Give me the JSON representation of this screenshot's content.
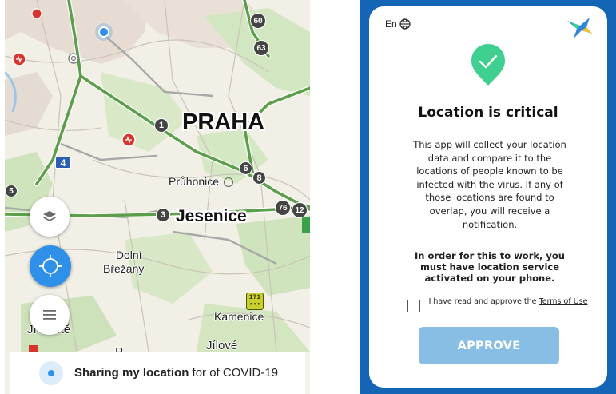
{
  "map_screen": {
    "labels": {
      "praha": "PRAHA",
      "jesenice": "Jesenice",
      "pruhonice": "Průhonice",
      "dolni_brezany_line1": "Dolní",
      "dolni_brezany_line2": "Břežany",
      "kamenice": "Kamenice",
      "jilove": "Jílové",
      "jilove_partial": "Jíloviště",
      "partial_bottom": "P"
    },
    "road_badges": {
      "r1": "1",
      "r3": "3",
      "r4": "4",
      "r6": "6",
      "r8": "8",
      "r60": "60",
      "r63": "63",
      "r76": "76",
      "r12": "12",
      "r5": "5"
    },
    "bus_badge": {
      "line1": "171",
      "line2": "•••"
    },
    "status_bar": {
      "bold_text": "Sharing my location",
      "rest_text": " for of COVID-19"
    },
    "colors": {
      "highway": "#5c9e4a",
      "road": "#9a9a9a",
      "accent_blue": "#2e90e8",
      "heart_red": "#d9342b"
    },
    "icons": [
      "layers-icon",
      "compass-icon",
      "menu-icon",
      "heart-marker-icon",
      "location-pin-icon"
    ]
  },
  "dialog": {
    "language": "En",
    "title": "Location is critical",
    "body": "This app will collect your location data and compare it to the locations of people known to be infected with the virus. If any of those locations are found to overlap, you will receive a notification.",
    "bold_notice": "In order for this to work, you must have location service activated on your phone.",
    "consent_prefix": "I have read and approve the ",
    "terms_link": "Terms of Use",
    "approve_label": "APPROVE",
    "checkbox_checked": false,
    "colors": {
      "frame": "#1565b7",
      "check_badge": "#3fcf8e",
      "approve_button": "#88bde4"
    },
    "icons": [
      "globe-icon",
      "app-logo-icon",
      "check-badge-icon"
    ]
  }
}
